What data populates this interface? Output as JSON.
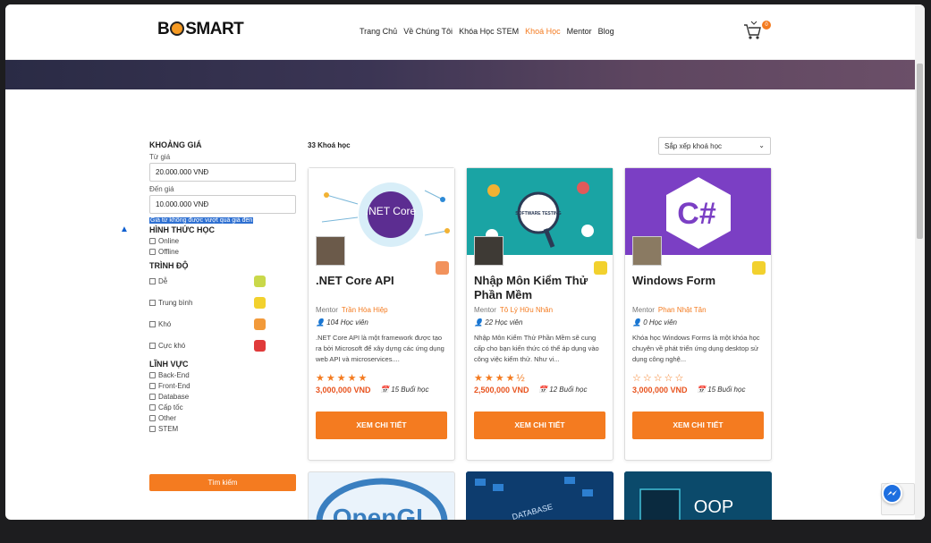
{
  "brand": {
    "logo_left": "B",
    "logo_right": "SMART"
  },
  "nav": [
    "Trang Chủ",
    "Về Chúng Tôi",
    "Khóa Học STEM",
    "Khoá Học",
    "Mentor",
    "Blog"
  ],
  "nav_active": 3,
  "cart": {
    "count": "0"
  },
  "filters": {
    "price_title": "KHOẢNG GIÁ",
    "from_label": "Từ giá",
    "from_value": "20.000.000 VNĐ",
    "to_label": "Đến giá",
    "to_value": "10.000.000 VNĐ",
    "warning": "Giá từ không được vượt quá giá đến",
    "mode_title": "HÌNH THỨC HỌC",
    "modes": [
      "Online",
      "Offline"
    ],
    "level_title": "TRÌNH ĐỘ",
    "levels": [
      "Dễ",
      "Trung bình",
      "Khó",
      "Cực khó"
    ],
    "field_title": "LĨNH VỰC",
    "fields": [
      "Back-End",
      "Front-End",
      "Database",
      "Cấp tốc",
      "Other",
      "STEM"
    ],
    "search_button": "Tìm kiếm"
  },
  "results": {
    "count_label": "33 Khoá học",
    "sort_placeholder": "Sắp xếp khoá học"
  },
  "mentor_label": "Mentor",
  "detail_button": "XEM CHI TIẾT",
  "courses": [
    {
      "title": ".NET Core API",
      "mentor": "Trần Hòa Hiệp",
      "students": "104 Học viên",
      "desc": ".NET Core API là một framework được tạo ra bởi Microsoft để xây dựng các ứng dụng web API và microservices....",
      "stars": "★★★★★",
      "price": "3,000,000 VND",
      "sessions": "15 Buổi học",
      "image_text": ".NET Core"
    },
    {
      "title": "Nhập Môn Kiểm Thử Phần Mềm",
      "mentor": "Tô Lý Hữu Nhân",
      "students": "22 Học viên",
      "desc": "Nhập Môn Kiểm Thử Phần Mềm sẽ cung cấp cho bạn kiến thức có thể áp dụng vào công việc kiểm thử. Như vi...",
      "stars": "★★★★½",
      "price": "2,500,000 VND",
      "sessions": "12 Buổi học",
      "image_text": "SOFTWARE TESTING"
    },
    {
      "title": "Windows Form",
      "mentor": "Phan Nhật Tân",
      "students": "0 Học viên",
      "desc": "Khóa học Windows Forms là một khóa học chuyên về phát triển ứng dụng desktop sử dụng công nghệ...",
      "stars": "☆☆☆☆☆",
      "price": "3,000,000 VND",
      "sessions": "15 Buổi học",
      "image_text": "C#"
    }
  ],
  "more_courses": [
    "OpenGL",
    "DATABASE",
    "OOP"
  ],
  "colors": {
    "accent": "#f47b20",
    "dotnet": "#5c2d91",
    "testing": "#1aa4a4",
    "csharp": "#7b3fc4"
  }
}
